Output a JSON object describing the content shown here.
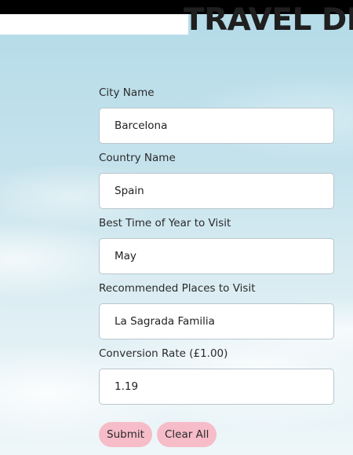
{
  "page": {
    "title": "TRAVEL DE"
  },
  "form": {
    "fields": [
      {
        "label": "City Name",
        "value": "Barcelona"
      },
      {
        "label": "Country Name",
        "value": "Spain"
      },
      {
        "label": "Best Time of Year to Visit",
        "value": "May"
      },
      {
        "label": "Recommended Places to Visit",
        "value": "La Sagrada Familia"
      },
      {
        "label": "Conversion Rate (£1.00)",
        "value": "1.19"
      }
    ],
    "submit_label": "Submit",
    "clear_label": "Clear All"
  },
  "colors": {
    "button_bg": "#f6bcc8",
    "title_text": "#1f1f1f",
    "sky": "#b3dbe8"
  }
}
